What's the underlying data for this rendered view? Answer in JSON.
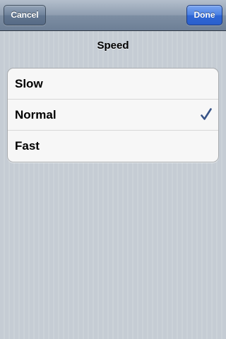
{
  "navbar": {
    "cancel_label": "Cancel",
    "done_label": "Done"
  },
  "section": {
    "title": "Speed"
  },
  "options": [
    {
      "label": "Slow",
      "selected": false
    },
    {
      "label": "Normal",
      "selected": true
    },
    {
      "label": "Fast",
      "selected": false
    }
  ],
  "colors": {
    "checkmark": "#385487",
    "done_button": "#2f67d6",
    "background": "#c5ccd4"
  },
  "icons": {
    "selected": "checkmark-icon"
  }
}
